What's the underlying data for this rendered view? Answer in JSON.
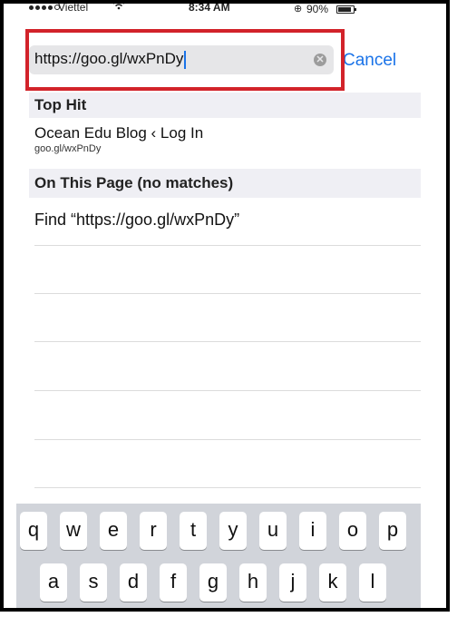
{
  "status": {
    "carrier": "Viettel",
    "time": "8:34 AM",
    "battery_percent": "90%",
    "battery_level": 0.9,
    "signal_bars": 4
  },
  "url_bar": {
    "value": "https://goo.gl/wxPnDy",
    "cancel_label": "Cancel"
  },
  "top_hit": {
    "heading": "Top Hit",
    "title": "Ocean Edu Blog ‹ Log In",
    "url": "goo.gl/wxPnDy"
  },
  "on_page": {
    "heading": "On This Page (no matches)",
    "find_label": "Find “https://goo.gl/wxPnDy”"
  },
  "keyboard": {
    "row1": [
      "q",
      "w",
      "e",
      "r",
      "t",
      "y",
      "u",
      "i",
      "o",
      "p"
    ],
    "row2": [
      "a",
      "s",
      "d",
      "f",
      "g",
      "h",
      "j",
      "k",
      "l"
    ]
  },
  "colors": {
    "accent": "#1a73e8",
    "highlight": "#d2232a",
    "section_bg": "#efeff4",
    "keyboard_bg": "#d1d4da"
  }
}
